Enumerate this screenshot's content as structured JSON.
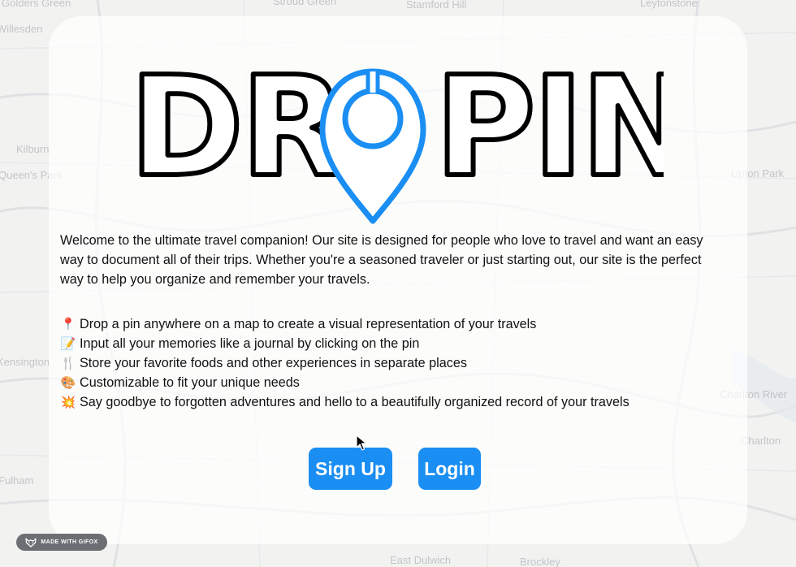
{
  "map": {
    "labels": [
      "Golders Green",
      "Stroud Green",
      "Stamford Hill",
      "Leytonstone",
      "Willesden",
      "Kilburn",
      "Queen's Park",
      "Upton Park",
      "Kensington",
      "Charlton",
      "Fulham",
      "East Dulwich",
      "Brockley",
      "Charlton River"
    ]
  },
  "logo": {
    "text_left": "DR",
    "text_right": "PIN",
    "pin_color": "#1a8ef3"
  },
  "intro": {
    "text": "Welcome to the ultimate travel companion! Our site is designed for people who love to travel and want an easy way to document all of their trips. Whether you're a seasoned traveler or just starting out, our site is the perfect way to help you organize and remember your travels."
  },
  "features": [
    {
      "icon": "round-pushpin-emoji",
      "glyph": "📍",
      "text": "Drop a pin anywhere on a map to create a visual representation of your travels"
    },
    {
      "icon": "memo-emoji",
      "glyph": "📝",
      "text": "Input all your memories like a journal by clicking on the pin"
    },
    {
      "icon": "fork-and-knife-emoji",
      "glyph": "🍴",
      "text": "Store your favorite foods and other experiences in separate places"
    },
    {
      "icon": "artist-palette-emoji",
      "glyph": "🎨",
      "text": "Customizable to fit your unique needs"
    },
    {
      "icon": "collision-emoji",
      "glyph": "💥",
      "text": "Say goodbye to forgotten adventures and hello to a beautifully organized record of your travels"
    }
  ],
  "buttons": {
    "signup_label": "Sign Up",
    "login_label": "Login",
    "color": "#1a8ef3"
  },
  "badge": {
    "label": "MADE WITH GIFOX",
    "icon": "fox-icon"
  }
}
